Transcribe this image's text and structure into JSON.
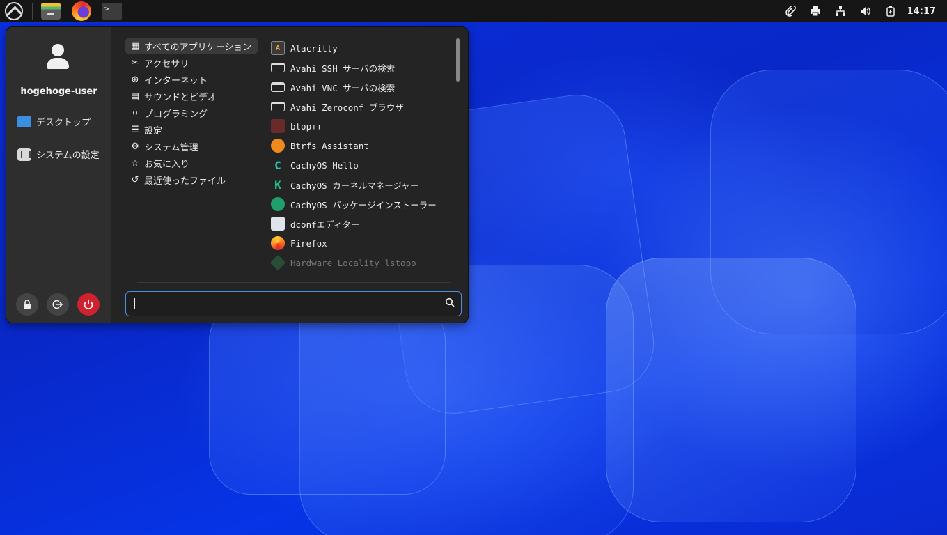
{
  "panel": {
    "clock": "14:17",
    "tray_icons": [
      "paperclip-icon",
      "printer-icon",
      "network-icon",
      "volume-icon",
      "battery-icon"
    ]
  },
  "menu": {
    "username": "hogehoge-user",
    "side_items": [
      {
        "label": "デスクトップ",
        "icon": "desktop-icon"
      },
      {
        "label": "システムの設定",
        "icon": "system-settings-icon"
      }
    ],
    "categories": [
      {
        "label": "すべてのアプリケーション",
        "icon": "grid-icon",
        "glyph": "▦",
        "active": true
      },
      {
        "label": "アクセサリ",
        "icon": "tools-icon",
        "glyph": "✂",
        "active": false
      },
      {
        "label": "インターネット",
        "icon": "globe-icon",
        "glyph": "⊕",
        "active": false
      },
      {
        "label": "サウンドとビデオ",
        "icon": "media-icon",
        "glyph": "▤",
        "active": false
      },
      {
        "label": "プログラミング",
        "icon": "code-icon",
        "glyph": "⟨⟩",
        "active": false
      },
      {
        "label": "設定",
        "icon": "sliders-icon",
        "glyph": "☰",
        "active": false
      },
      {
        "label": "システム管理",
        "icon": "gear-icon",
        "glyph": "⚙",
        "active": false
      },
      {
        "label": "お気に入り",
        "icon": "star-icon",
        "glyph": "☆",
        "active": false
      },
      {
        "label": "最近使ったファイル",
        "icon": "history-icon",
        "glyph": "↺",
        "active": false
      }
    ],
    "apps": [
      {
        "label": "Alacritty",
        "icon": "alacritty-icon"
      },
      {
        "label": "Avahi SSH サーバの検索",
        "icon": "window-icon"
      },
      {
        "label": "Avahi VNC サーバの検索",
        "icon": "window-icon"
      },
      {
        "label": "Avahi Zeroconf ブラウザ",
        "icon": "window-icon"
      },
      {
        "label": "btop++",
        "icon": "btop-icon"
      },
      {
        "label": "Btrfs Assistant",
        "icon": "btrfs-icon"
      },
      {
        "label": "CachyOS Hello",
        "icon": "cachyos-icon"
      },
      {
        "label": "CachyOS カーネルマネージャー",
        "icon": "kernel-manager-icon"
      },
      {
        "label": "CachyOS パッケージインストーラー",
        "icon": "package-installer-icon"
      },
      {
        "label": "dconfエディター",
        "icon": "dconf-icon"
      },
      {
        "label": "Firefox",
        "icon": "firefox-icon"
      },
      {
        "label": "Hardware Locality lstopo",
        "icon": "hwloc-icon"
      }
    ],
    "search": {
      "value": "",
      "placeholder": ""
    }
  }
}
